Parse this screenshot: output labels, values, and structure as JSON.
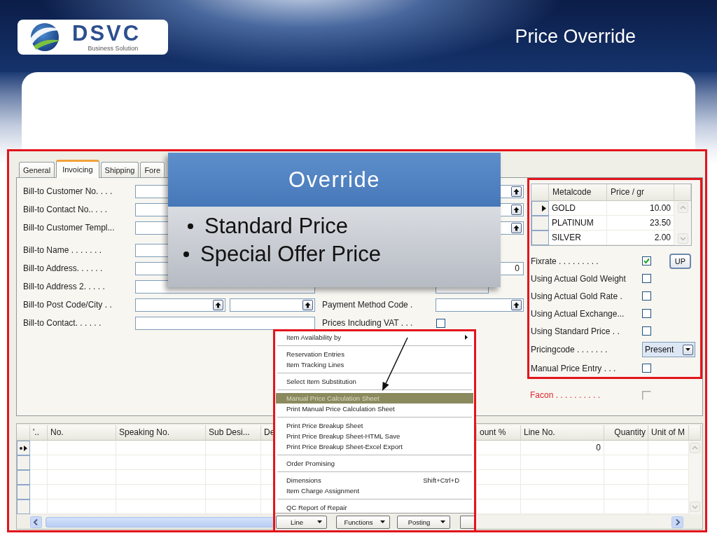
{
  "slide": {
    "logo": {
      "name": "DSVC",
      "tagline": "Business Solution"
    },
    "title": "Price Override"
  },
  "tabs": [
    {
      "label": "General",
      "selected": false
    },
    {
      "label": "Invoicing",
      "selected": true
    },
    {
      "label": "Shipping",
      "selected": false
    },
    {
      "label": "Fore",
      "selected": false
    }
  ],
  "left_fields": [
    {
      "kind": "text",
      "label": "Bill-to Customer No. . . ."
    },
    {
      "kind": "text",
      "label": "Bill-to Contact No.. . . ."
    },
    {
      "kind": "text",
      "label": "Bill-to Customer Templ..."
    },
    {
      "kind": "text",
      "label": "Bill-to Name . . . . . . ."
    },
    {
      "kind": "text",
      "label": "Bill-to Address. . . . . ."
    },
    {
      "kind": "text",
      "label": "Bill-to Address 2. . . . ."
    },
    {
      "kind": "pair",
      "label": "Bill-to Post Code/City . ."
    },
    {
      "kind": "text",
      "label": "Bill-to Contact. . . . . ."
    }
  ],
  "middle_fields": [
    {
      "kind": "lookup"
    },
    {
      "kind": "lookup"
    },
    {
      "kind": "lookup"
    },
    {
      "kind": "none"
    },
    {
      "kind": "text",
      "value": "0"
    },
    {
      "kind": "short"
    },
    {
      "kind": "lookup",
      "label": "Payment Method Code ."
    },
    {
      "kind": "checkbox",
      "label": "Prices Including VAT . . .",
      "checked": false
    }
  ],
  "metal_grid": {
    "columns": [
      "Metalcode",
      "Price / gr"
    ],
    "rows": [
      {
        "metalcode": "GOLD",
        "price": "10.00",
        "selected": true
      },
      {
        "metalcode": "PLATINUM",
        "price": "23.50",
        "selected": false
      },
      {
        "metalcode": "SILVER",
        "price": "2.00",
        "selected": false
      }
    ]
  },
  "options": [
    {
      "kind": "checkbox",
      "label": "Fixrate . . . . . . . . .",
      "checked": true,
      "button": "UP"
    },
    {
      "kind": "checkbox",
      "label": "Using Actual Gold Weight",
      "checked": false
    },
    {
      "kind": "checkbox",
      "label": "Using Actual Gold Rate .",
      "checked": false
    },
    {
      "kind": "checkbox",
      "label": "Using Actual Exchange...",
      "checked": false
    },
    {
      "kind": "checkbox",
      "label": "Using Standard Price . .",
      "checked": false
    },
    {
      "kind": "select",
      "label": "Pricingcode . . . . . . .",
      "value": "Present"
    },
    {
      "kind": "checkbox",
      "label": "Manual Price Entry . . .",
      "checked": false
    }
  ],
  "facon": {
    "label": "Facon . . . . . . . . . .",
    "checked": false,
    "disabled": true
  },
  "lines_table": {
    "columns": [
      "'..",
      "No.",
      "Speaking No.",
      "Sub Desi...",
      "De",
      "ount %",
      "Line No.",
      "Quantity",
      "Unit of M"
    ],
    "rows": [
      {
        "selected": true,
        "line_no": "0"
      },
      {
        "selected": false
      },
      {
        "selected": false
      },
      {
        "selected": false
      },
      {
        "selected": false
      }
    ]
  },
  "line_menu": {
    "groups": [
      {
        "items": [
          {
            "label": "Item Availability by",
            "submenu": true,
            "selected": false
          }
        ]
      },
      {
        "items": [
          {
            "label": "Reservation Entries",
            "submenu": false,
            "selected": false
          },
          {
            "label": "Item Tracking Lines",
            "submenu": false,
            "selected": false
          }
        ]
      },
      {
        "items": [
          {
            "label": "Select Item Substitution",
            "submenu": false,
            "selected": false
          }
        ]
      },
      {
        "items": [
          {
            "label": "Manual Price Calculation Sheet",
            "submenu": false,
            "selected": true
          },
          {
            "label": "Print Manual Price Calculation Sheet",
            "submenu": false,
            "selected": false
          }
        ]
      },
      {
        "items": [
          {
            "label": "Print Price Breakup Sheet",
            "submenu": false,
            "selected": false
          },
          {
            "label": "Print Price Breakup Sheet-HTML Save",
            "submenu": false,
            "selected": false
          },
          {
            "label": "Print Price Breakup Sheet-Excel Export",
            "submenu": false,
            "selected": false
          }
        ]
      },
      {
        "items": [
          {
            "label": "Order Promising",
            "submenu": false,
            "selected": false
          }
        ]
      },
      {
        "items": [
          {
            "label": "Dimensions",
            "shortcut": "Shift+Ctrl+D",
            "submenu": false,
            "selected": false
          },
          {
            "label": "Item Charge Assignment",
            "submenu": false,
            "selected": false
          }
        ]
      },
      {
        "items": [
          {
            "label": "QC Report of Repair",
            "submenu": false,
            "selected": false
          }
        ]
      }
    ]
  },
  "buttons": [
    {
      "kind": "dropdown",
      "label": "Line"
    },
    {
      "kind": "dropdown",
      "label": "Functions"
    },
    {
      "kind": "dropdown",
      "label": "Posting"
    },
    {
      "kind": "cut"
    }
  ],
  "callout": {
    "title": "Override",
    "bullets": [
      "Standard Price",
      "Special Offer Price"
    ]
  }
}
